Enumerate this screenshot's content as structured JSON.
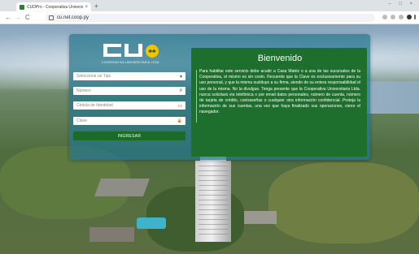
{
  "browser": {
    "tab_title": "CUDPro - Cooperativa Universitaria",
    "tab_close": "×",
    "new_tab": "+",
    "url": "cu.net.coop.py",
    "window_controls": "– □ ×",
    "back": "←",
    "forward": "→",
    "reload": "C"
  },
  "logo": {
    "letters": "CU",
    "emblem": "♣♣",
    "subtitle": "COOPERATIVA UNIVERSITARIA LTDA"
  },
  "form": {
    "type_placeholder": "Seleccione un Tipo",
    "type_icon": "▾",
    "number_placeholder": "Número",
    "number_icon": "#",
    "id_placeholder": "Cédula de Identidad",
    "id_icon": "▭",
    "password_placeholder": "Clave",
    "password_icon": "🔒",
    "submit_label": "INGRESAR"
  },
  "welcome": {
    "title": "Bienvenido",
    "body": "Para habilitar este servicio debe acudir a Casa Matriz o a una de las sucursales de la Cooperativa, el mismo es sin costo. Recuerde que la Clave es exclusivamente para su uso personal, y que la misma sustituye a su firma, siendo de su entera responsabilidad el uso de la misma. No la divulgue. Tenga presente que la Cooperativa Universitaria Ltda. nunca solicitará vía telefónica o por email datos personales, número de cuenta, número de tarjeta de crédito, contraseñas o cualquier otra información confidencial. Proteja la información de sus cuentas, una vez que haya finalizado sus operaciones, cierre el navegador."
  },
  "colors": {
    "card": "#24768c",
    "welcome_panel": "#1e6e2d",
    "button": "#1b6b2a",
    "accent": "#f2c400"
  }
}
